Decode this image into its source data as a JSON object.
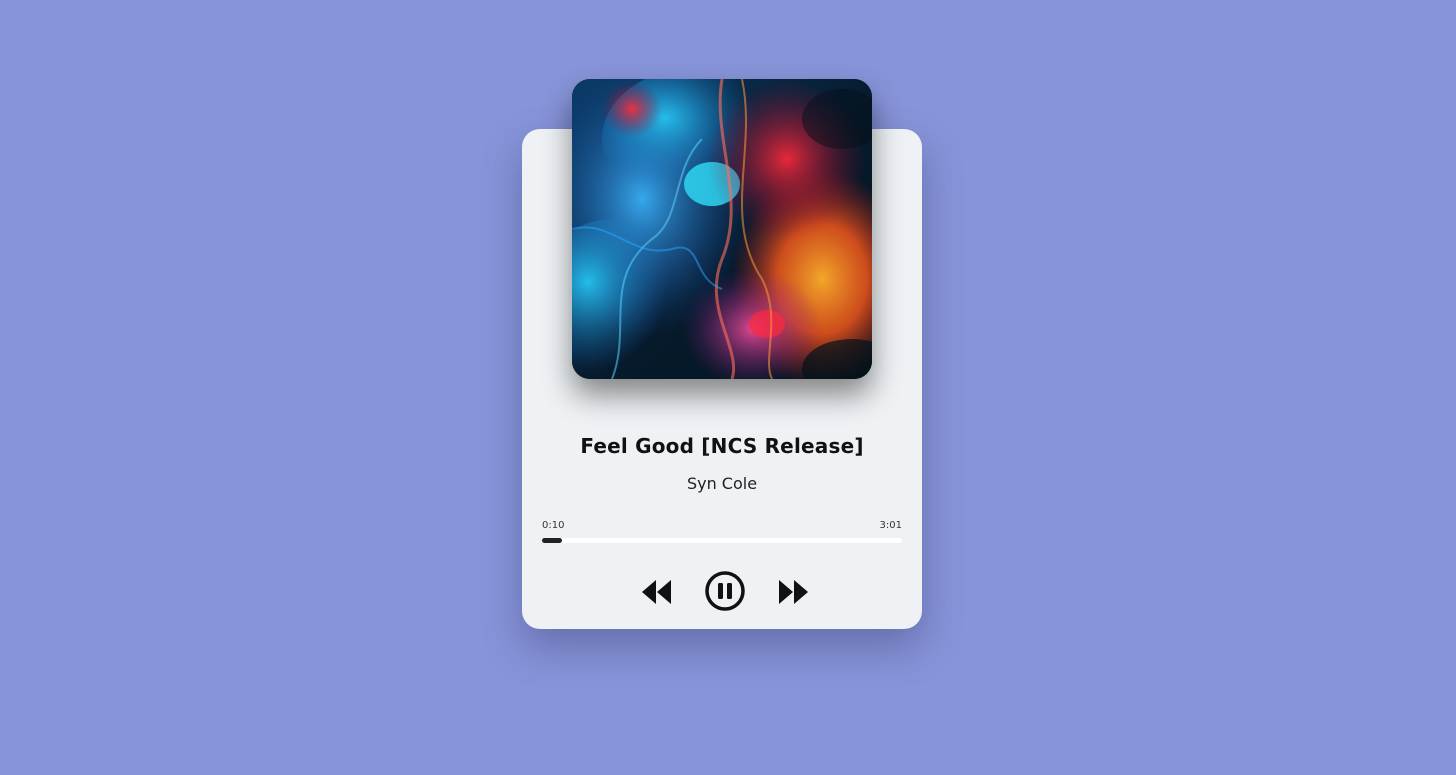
{
  "track": {
    "title": "Feel Good [NCS Release]",
    "artist": "Syn Cole",
    "cover_icon": "album-cover-image"
  },
  "progress": {
    "current_time": "0:10",
    "duration": "3:01",
    "fraction": 0.0552
  },
  "controls": {
    "previous_icon": "rewind-icon",
    "play_pause_icon": "pause-circle-icon",
    "next_icon": "fast-forward-icon"
  },
  "colors": {
    "background": "#8794d9",
    "card": "#eef2f5",
    "accent": "#111111"
  }
}
